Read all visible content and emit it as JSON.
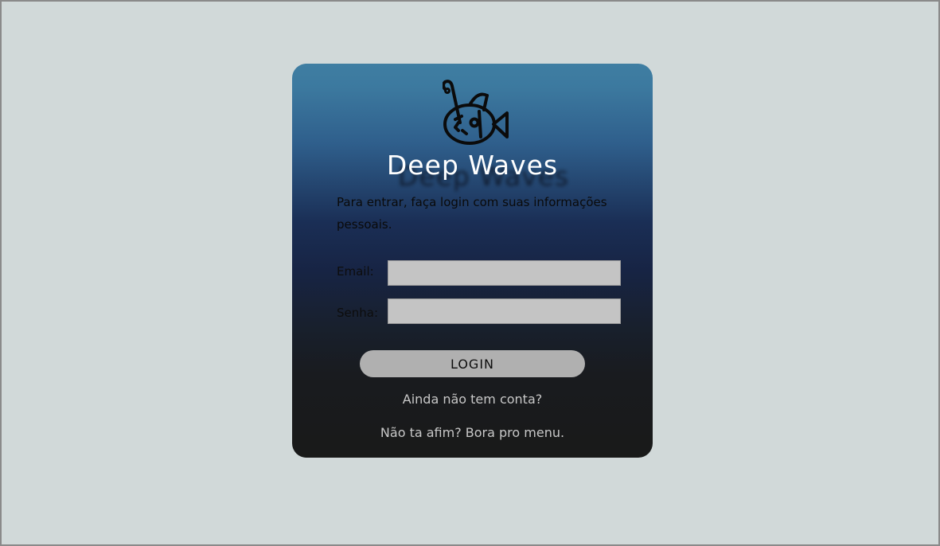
{
  "brand": {
    "name": "Deep Waves",
    "logo_icon": "anglerfish-icon"
  },
  "login_form": {
    "subtitle": "Para entrar, faça login com suas informações pessoais.",
    "email_label": "Email:",
    "email_value": "",
    "senha_label": "Senha:",
    "senha_value": "",
    "submit_label": "LOGIN"
  },
  "links": {
    "signup": "Ainda não tem conta?",
    "menu": "Não ta afim? Bora pro menu."
  },
  "colors": {
    "page_background": "#d1d9d9",
    "card_top": "#3f7ea2",
    "card_middle": "#172444",
    "card_bottom": "#191a19",
    "input_background": "#c4c4c4",
    "button_background": "#b0b0b0",
    "link_text": "#c8c8c8"
  }
}
